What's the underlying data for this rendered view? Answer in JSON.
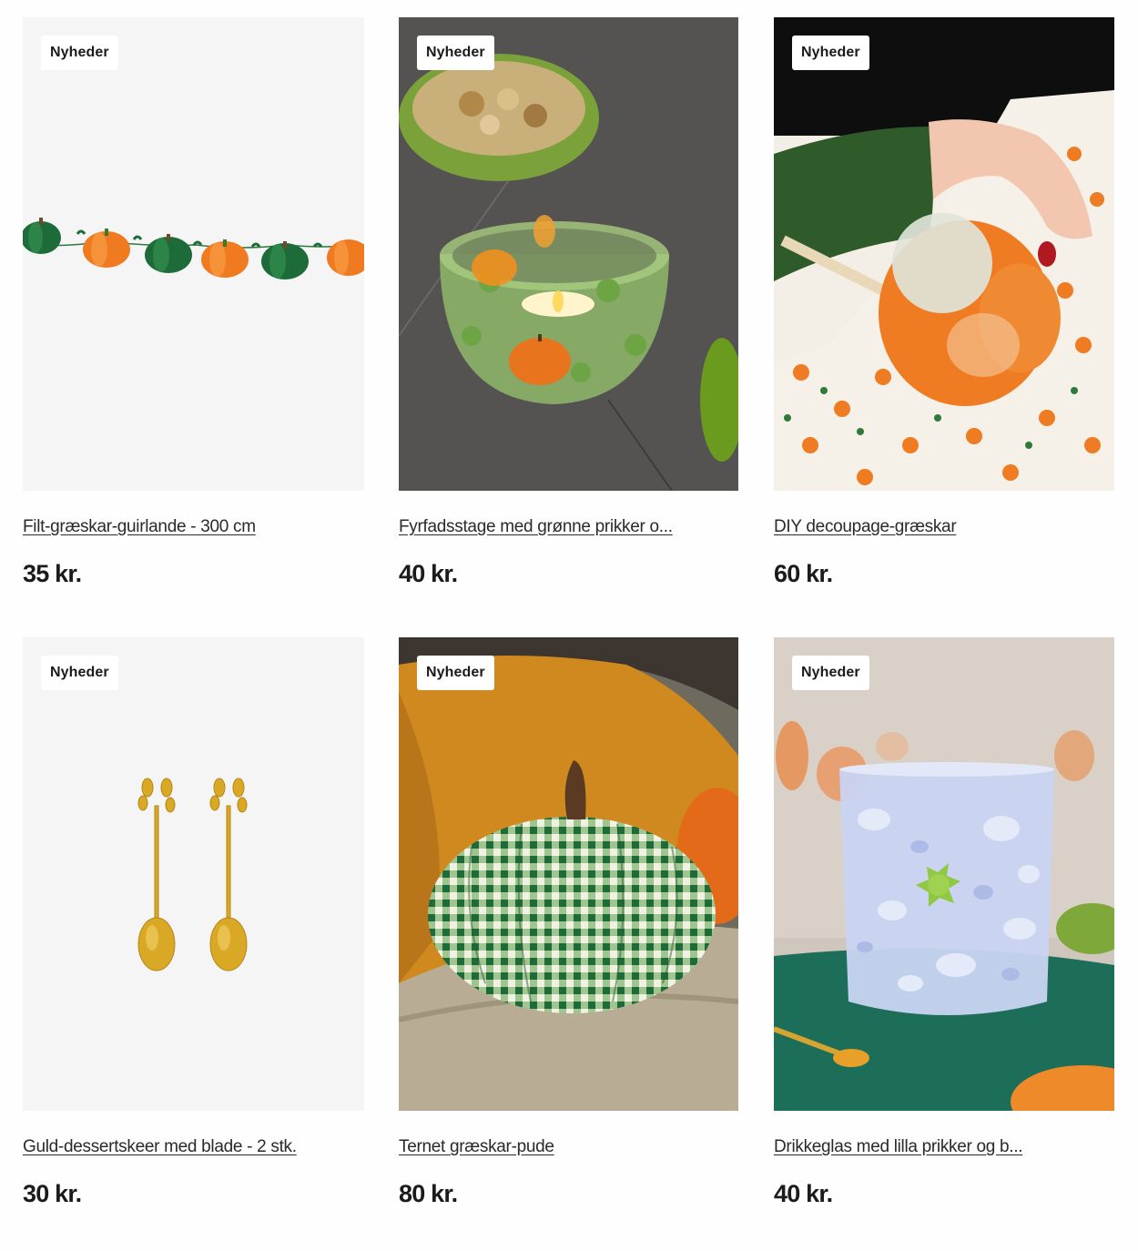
{
  "products": [
    {
      "badge": "Nyheder",
      "title": "Filt-græskar-guirlande - 300 cm",
      "price": "35 kr."
    },
    {
      "badge": "Nyheder",
      "title": "Fyrfadsstage med grønne prikker o...",
      "price": "40 kr."
    },
    {
      "badge": "Nyheder",
      "title": "DIY decoupage-græskar",
      "price": "60 kr."
    },
    {
      "badge": "Nyheder",
      "title": "Guld-dessertskeer med blade - 2 stk.",
      "price": "30 kr."
    },
    {
      "badge": "Nyheder",
      "title": "Ternet græskar-pude",
      "price": "80 kr."
    },
    {
      "badge": "Nyheder",
      "title": "Drikkeglas med lilla prikker og b...",
      "price": "40 kr."
    }
  ],
  "colors": {
    "accent": "#1b1b1b",
    "placeholder_bg": "#f5f5f5"
  }
}
